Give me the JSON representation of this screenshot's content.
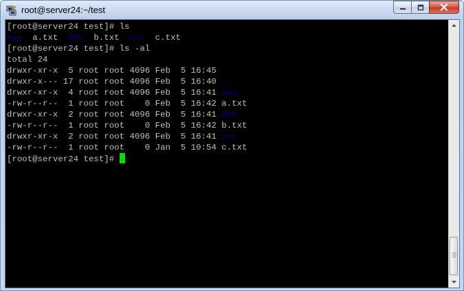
{
  "window": {
    "title": "root@server24:~/test",
    "icon": "putty-icon",
    "controls": [
      "minimize-icon",
      "maximize-icon",
      "close-icon"
    ]
  },
  "colors": {
    "terminal_bg": "#000000",
    "terminal_fg": "#c0c0c0",
    "directory": "#00007a",
    "cursor": "#00e000"
  },
  "terminal": {
    "lines": [
      [
        {
          "t": "[root@server24 test]# ls"
        }
      ],
      [
        {
          "t": "aaa",
          "dir": true
        },
        {
          "t": "  a.txt  "
        },
        {
          "t": "bbb",
          "dir": true
        },
        {
          "t": "  b.txt  "
        },
        {
          "t": "ccc",
          "dir": true
        },
        {
          "t": "  c.txt"
        }
      ],
      [
        {
          "t": "[root@server24 test]# ls -al"
        }
      ],
      [
        {
          "t": "total 24"
        }
      ],
      [
        {
          "t": "drwxr-xr-x  5 root root 4096 Feb  5 16:45 "
        },
        {
          "t": ".",
          "dir": true
        }
      ],
      [
        {
          "t": "drwxr-x--- 17 root root 4096 Feb  5 16:40 "
        },
        {
          "t": "..",
          "dir": true
        }
      ],
      [
        {
          "t": "drwxr-xr-x  4 root root 4096 Feb  5 16:41 "
        },
        {
          "t": "aaa",
          "dir": true
        }
      ],
      [
        {
          "t": "-rw-r--r--  1 root root    0 Feb  5 16:42 a.txt"
        }
      ],
      [
        {
          "t": "drwxr-xr-x  2 root root 4096 Feb  5 16:41 "
        },
        {
          "t": "bbb",
          "dir": true
        }
      ],
      [
        {
          "t": "-rw-r--r--  1 root root    0 Feb  5 16:42 b.txt"
        }
      ],
      [
        {
          "t": "drwxr-xr-x  2 root root 4096 Feb  5 16:41 "
        },
        {
          "t": "ccc",
          "dir": true
        }
      ],
      [
        {
          "t": "-rw-r--r--  1 root root    0 Jan  5 10:54 c.txt"
        }
      ]
    ],
    "prompt": "[root@server24 test]# "
  },
  "scrollbar": {
    "up_icon": "scroll-up-arrow-icon",
    "down_icon": "scroll-down-arrow-icon",
    "thumb_position": "bottom"
  }
}
